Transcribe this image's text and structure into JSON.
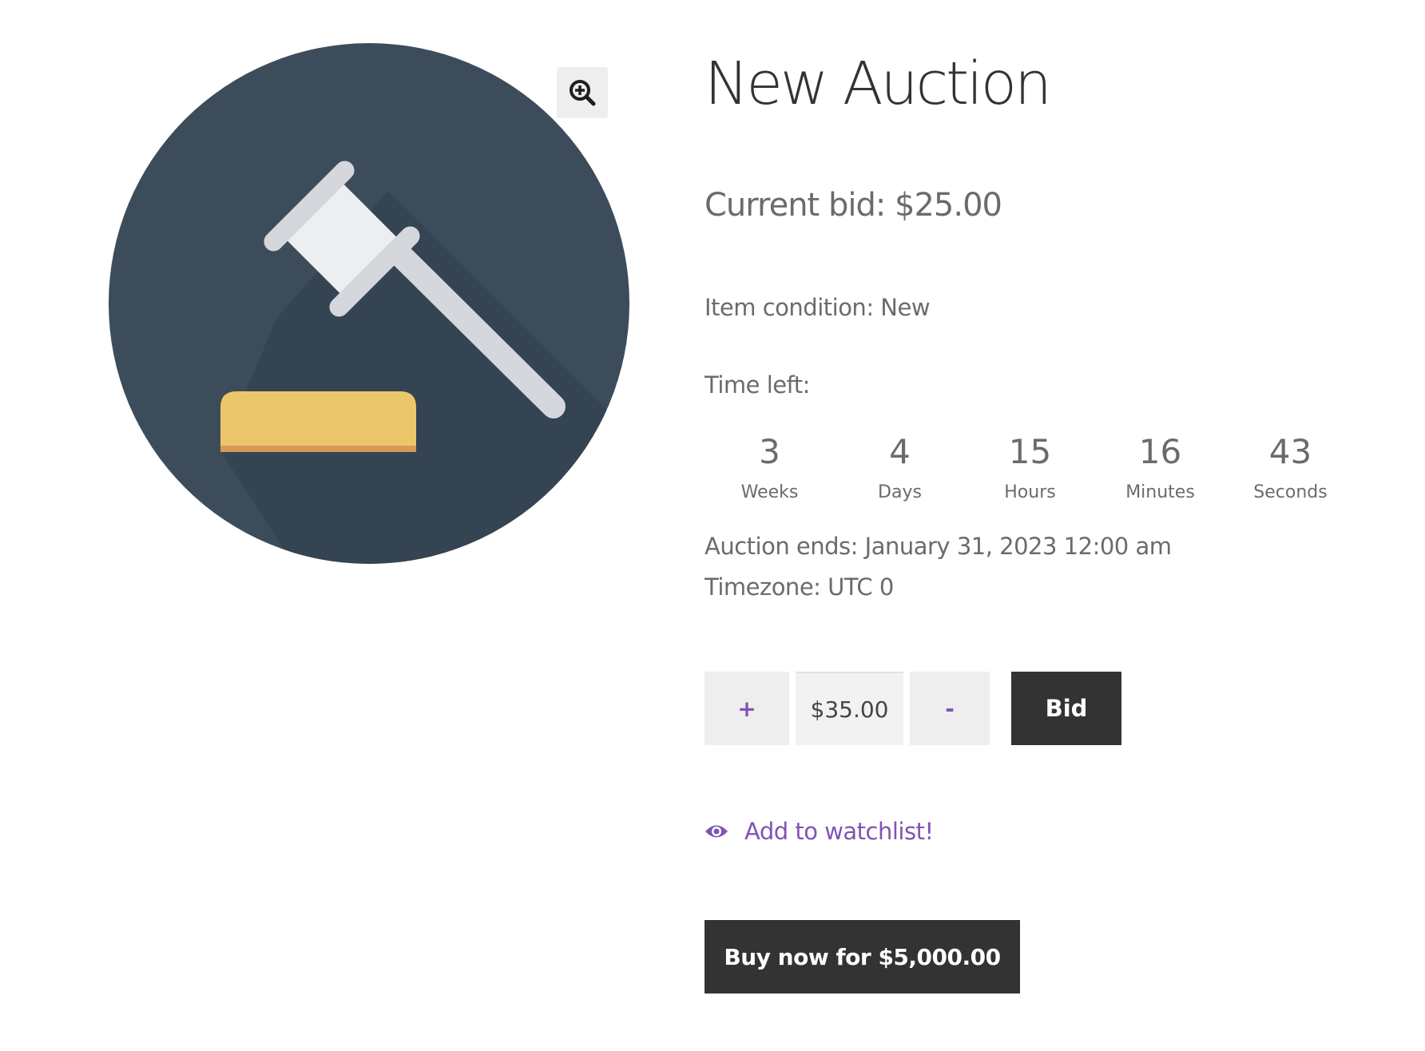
{
  "product": {
    "title": "New Auction",
    "current_bid": "Current bid: $25.00",
    "condition": "Item condition: New",
    "time_left_label": "Time left:",
    "countdown": [
      {
        "value": "3",
        "unit": "Weeks"
      },
      {
        "value": "4",
        "unit": "Days"
      },
      {
        "value": "15",
        "unit": "Hours"
      },
      {
        "value": "16",
        "unit": "Minutes"
      },
      {
        "value": "43",
        "unit": "Seconds"
      }
    ],
    "auction_ends": "Auction ends: January 31, 2023 12:00 am",
    "timezone": "Timezone: UTC 0"
  },
  "bid_form": {
    "plus_label": "+",
    "minus_label": "-",
    "bid_value": "$35.00",
    "bid_button": "Bid"
  },
  "watchlist": {
    "label": "Add to watchlist!",
    "icon": "eye-icon"
  },
  "buy_now": {
    "label": "Buy now for $5,000.00"
  },
  "image": {
    "icon": "gavel-icon",
    "zoom_icon": "zoom-in-icon"
  },
  "colors": {
    "circle": "#3c4c5a",
    "shadow": "#344452",
    "gavel_head": "#eceef0",
    "gavel_handle": "#d5d7dc",
    "block": "#ecc66b",
    "block_edge": "#d59a55",
    "accent": "#7f54b3",
    "button_dark": "#333333"
  }
}
